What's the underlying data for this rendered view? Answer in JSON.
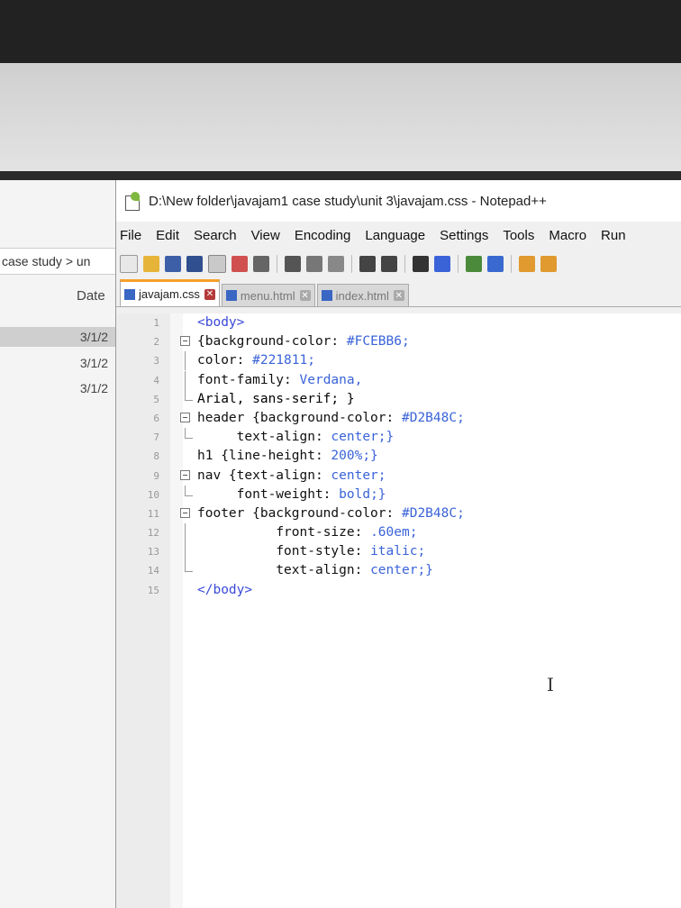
{
  "explorer": {
    "breadcrumb": "case study  >  un",
    "column_header": "Date",
    "rows": [
      "3/1/2",
      "3/1/2",
      "3/1/2"
    ]
  },
  "npp": {
    "title": "D:\\New folder\\javajam1 case study\\unit 3\\javajam.css - Notepad++",
    "menu": [
      "File",
      "Edit",
      "Search",
      "View",
      "Encoding",
      "Language",
      "Settings",
      "Tools",
      "Macro",
      "Run"
    ],
    "tabs": [
      {
        "label": "javajam.css",
        "active": true
      },
      {
        "label": "menu.html",
        "active": false
      },
      {
        "label": "index.html",
        "active": false
      }
    ]
  },
  "code_lines": [
    {
      "n": "1",
      "text": "<body>"
    },
    {
      "n": "2",
      "text": "{background-color: #FCEBB6;"
    },
    {
      "n": "3",
      "text": "color: #221811;"
    },
    {
      "n": "4",
      "text": "font-family: Verdana,"
    },
    {
      "n": "5",
      "text": "Arial, sans-serif; }"
    },
    {
      "n": "6",
      "text": "header {background-color: #D2B48C;"
    },
    {
      "n": "7",
      "text": "     text-align: center;}"
    },
    {
      "n": "8",
      "text": "h1 {line-height: 200%;}"
    },
    {
      "n": "9",
      "text": "nav {text-align: center;"
    },
    {
      "n": "10",
      "text": "     font-weight: bold;}"
    },
    {
      "n": "11",
      "text": "footer {background-color: #D2B48C;"
    },
    {
      "n": "12",
      "text": "          front-size: .60em;"
    },
    {
      "n": "13",
      "text": "          font-style: italic;"
    },
    {
      "n": "14",
      "text": "          text-align: center;}"
    },
    {
      "n": "15",
      "text": "</body>"
    }
  ],
  "colors": {
    "tag": "#3a4ad8",
    "property": "#101010",
    "value": "#3a63d8",
    "active_tab_accent": "#f6a02a"
  }
}
